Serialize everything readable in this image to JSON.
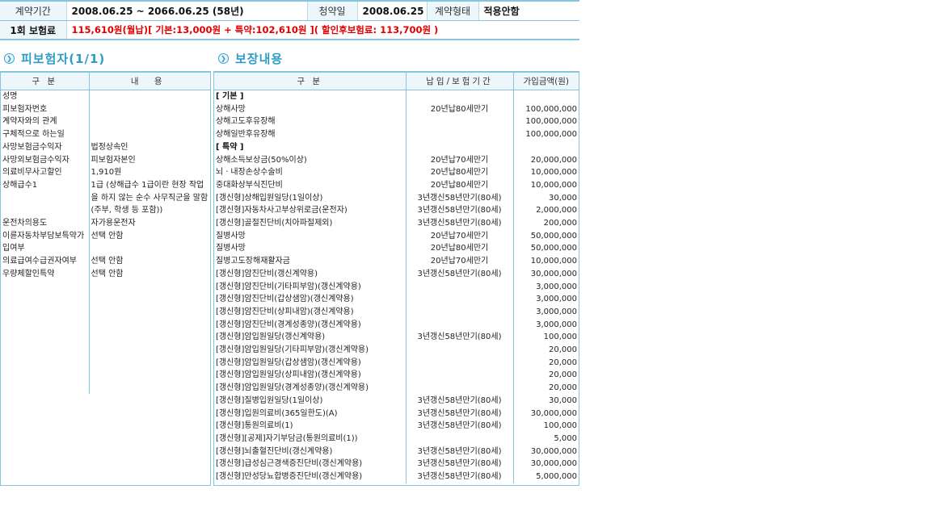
{
  "contract": {
    "period_label": "계약기간",
    "period_value": "2008.06.25  ~ 2066.06.25  (58년)",
    "subscribe_label": "청약일",
    "subscribe_value": "2008.06.25",
    "type_label": "계약형태",
    "type_value": "적용안함",
    "premium_label": "1회 보험료",
    "premium_value": "115,610원(월납)[ 기본:13,000원 + 특약:102,610원 ]( 할인후보험료: 113,700원 )"
  },
  "insured_section": {
    "title": "피보험자(1/1)",
    "col_category": "구 분",
    "col_content": "내 용",
    "rows": [
      {
        "label": "성명",
        "value": ""
      },
      {
        "label": "피보험자번호",
        "value": ""
      },
      {
        "label": "계약자와의 관계",
        "value": ""
      },
      {
        "label": "구체적으로 하는일",
        "value": ""
      },
      {
        "label": "사망보험금수익자",
        "value": "법정상속인"
      },
      {
        "label": "사망외보험금수익자",
        "value": "피보험자본인"
      },
      {
        "label": "의료비무사고할인",
        "value": "1,910원"
      },
      {
        "label": "상해급수1",
        "value": "1급 (상해급수 1급이란 현장 작업을 하지 않는 순수 사무직군을 말함(주부, 학생 등 포함))"
      },
      {
        "label": "운전차의용도",
        "value": "자가용운전자"
      },
      {
        "label": "이륜자동차부담보특약가입여부",
        "value": "선택 안함"
      },
      {
        "label": "의료급여수급권자여부",
        "value": "선택 안함"
      },
      {
        "label": "우량체할인특약",
        "value": "선택 안함"
      }
    ]
  },
  "coverage_section": {
    "title": "보장내용",
    "col_category": "구 분",
    "col_period": "납입/보험기간",
    "col_amount": "가입금액(원)",
    "rows": [
      {
        "name": "[ 기본 ]",
        "period": "",
        "amount": "",
        "bold": true
      },
      {
        "name": "상해사망",
        "period": "20년납80세만기",
        "amount": "100,000,000"
      },
      {
        "name": "상해고도후유장해",
        "period": "",
        "amount": "100,000,000"
      },
      {
        "name": "상해일반후유장해",
        "period": "",
        "amount": "100,000,000"
      },
      {
        "name": "[ 특약 ]",
        "period": "",
        "amount": "",
        "bold": true
      },
      {
        "name": "상해소득보상금(50%이상)",
        "period": "20년납70세만기",
        "amount": "20,000,000"
      },
      {
        "name": "뇌ㆍ내장손상수술비",
        "period": "20년납80세만기",
        "amount": "10,000,000"
      },
      {
        "name": "중대화상부식진단비",
        "period": "20년납80세만기",
        "amount": "10,000,000"
      },
      {
        "name": "[갱신형]상해입원일당(1일이상)",
        "period": "3년갱신58년만기(80세)",
        "amount": "30,000"
      },
      {
        "name": "[갱신형]자동차사고부상위로금(운전자)",
        "period": "3년갱신58년만기(80세)",
        "amount": "2,000,000"
      },
      {
        "name": "[갱신형]골절진단비(치아파절제외)",
        "period": "3년갱신58년만기(80세)",
        "amount": "200,000"
      },
      {
        "name": "질병사망",
        "period": "20년납70세만기",
        "amount": "50,000,000"
      },
      {
        "name": "질병사망",
        "period": "20년납80세만기",
        "amount": "50,000,000"
      },
      {
        "name": "질병고도장해재활자금",
        "period": "20년납70세만기",
        "amount": "10,000,000"
      },
      {
        "name": "[갱신형]암진단비(갱신계약용)",
        "period": "3년갱신58년만기(80세)",
        "amount": "30,000,000"
      },
      {
        "name": "[갱신형]암진단비(기타피부암)(갱신계약용)",
        "period": "",
        "amount": "3,000,000"
      },
      {
        "name": "[갱신형]암진단비(갑상샘암)(갱신계약용)",
        "period": "",
        "amount": "3,000,000"
      },
      {
        "name": "[갱신형]암진단비(상피내암)(갱신계약용)",
        "period": "",
        "amount": "3,000,000"
      },
      {
        "name": "[갱신형]암진단비(경계성종양)(갱신계약용)",
        "period": "",
        "amount": "3,000,000"
      },
      {
        "name": "[갱신형]암입원일당(갱신계약용)",
        "period": "3년갱신58년만기(80세)",
        "amount": "100,000"
      },
      {
        "name": "[갱신형]암입원일당(기타피부암)(갱신계약용)",
        "period": "",
        "amount": "20,000"
      },
      {
        "name": "[갱신형]암입원일당(갑상샘암)(갱신계약용)",
        "period": "",
        "amount": "20,000"
      },
      {
        "name": "[갱신형]암입원일당(상피내암)(갱신계약용)",
        "period": "",
        "amount": "20,000"
      },
      {
        "name": "[갱신형]암입원일당(경계성종양)(갱신계약용)",
        "period": "",
        "amount": "20,000"
      },
      {
        "name": "[갱신형]질병입원일당(1일이상)",
        "period": "3년갱신58년만기(80세)",
        "amount": "30,000"
      },
      {
        "name": "[갱신형]입원의료비(365일한도)(A)",
        "period": "3년갱신58년만기(80세)",
        "amount": "30,000,000"
      },
      {
        "name": "[갱신형]통원의료비(1)",
        "period": "3년갱신58년만기(80세)",
        "amount": "100,000"
      },
      {
        "name": "[갱신형][공제]자기부담금(통원의료비(1))",
        "period": "",
        "amount": "5,000"
      },
      {
        "name": "[갱신형]뇌출혈진단비(갱신계약용)",
        "period": "3년갱신58년만기(80세)",
        "amount": "30,000,000"
      },
      {
        "name": "[갱신형]급성심근경색증진단비(갱신계약용)",
        "period": "3년갱신58년만기(80세)",
        "amount": "30,000,000"
      },
      {
        "name": "[갱신형]만성당뇨합병증진단비(갱신계약용)",
        "period": "3년갱신58년만기(80세)",
        "amount": "5,000,000"
      }
    ]
  }
}
